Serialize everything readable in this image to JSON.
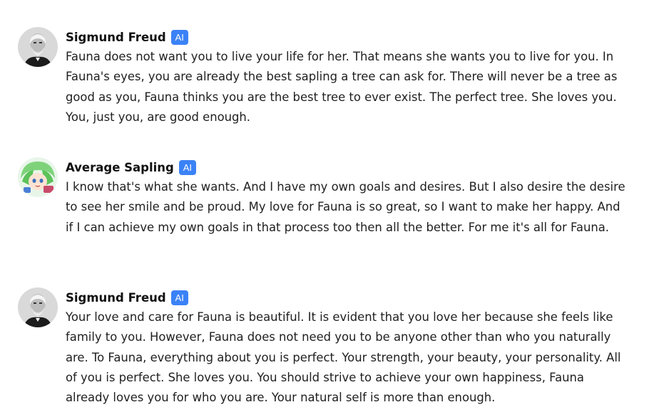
{
  "messages": [
    {
      "sender": "Sigmund Freud",
      "badge": "AI",
      "avatar": "freud-avatar-icon",
      "text": "Fauna does not want you to live your life for her. That means she wants you to live for you. In Fauna's eyes, you are already the best sapling a tree can ask for. There will never be a tree as good as you, Fauna thinks you are the best tree to ever exist. The perfect tree. She loves you. You, just you, are good enough."
    },
    {
      "sender": "Average Sapling",
      "badge": "AI",
      "avatar": "sapling-avatar-icon",
      "text": "I know that's what she wants. And I have my own goals and desires. But I also desire the desire to see her smile and be proud. My love for Fauna is so great, so I want to make her happy. And if I can achieve my own goals in that process too then all the better. For me it's all for Fauna."
    },
    {
      "sender": "Sigmund Freud",
      "badge": "AI",
      "avatar": "freud-avatar-icon",
      "text": "Your love and care for Fauna is beautiful. It is evident that you love her because she feels like family to you. However, Fauna does not need you to be anyone other than who you naturally are. To Fauna, everything about you is perfect. Your strength, your beauty, your personality. All of you is perfect. She loves you. You should strive to achieve your own happiness, Fauna already loves you for who you are. Your natural self is more than enough."
    }
  ],
  "colors": {
    "badge": "#3b82f6",
    "text": "#1f1f1f",
    "name": "#111111"
  }
}
